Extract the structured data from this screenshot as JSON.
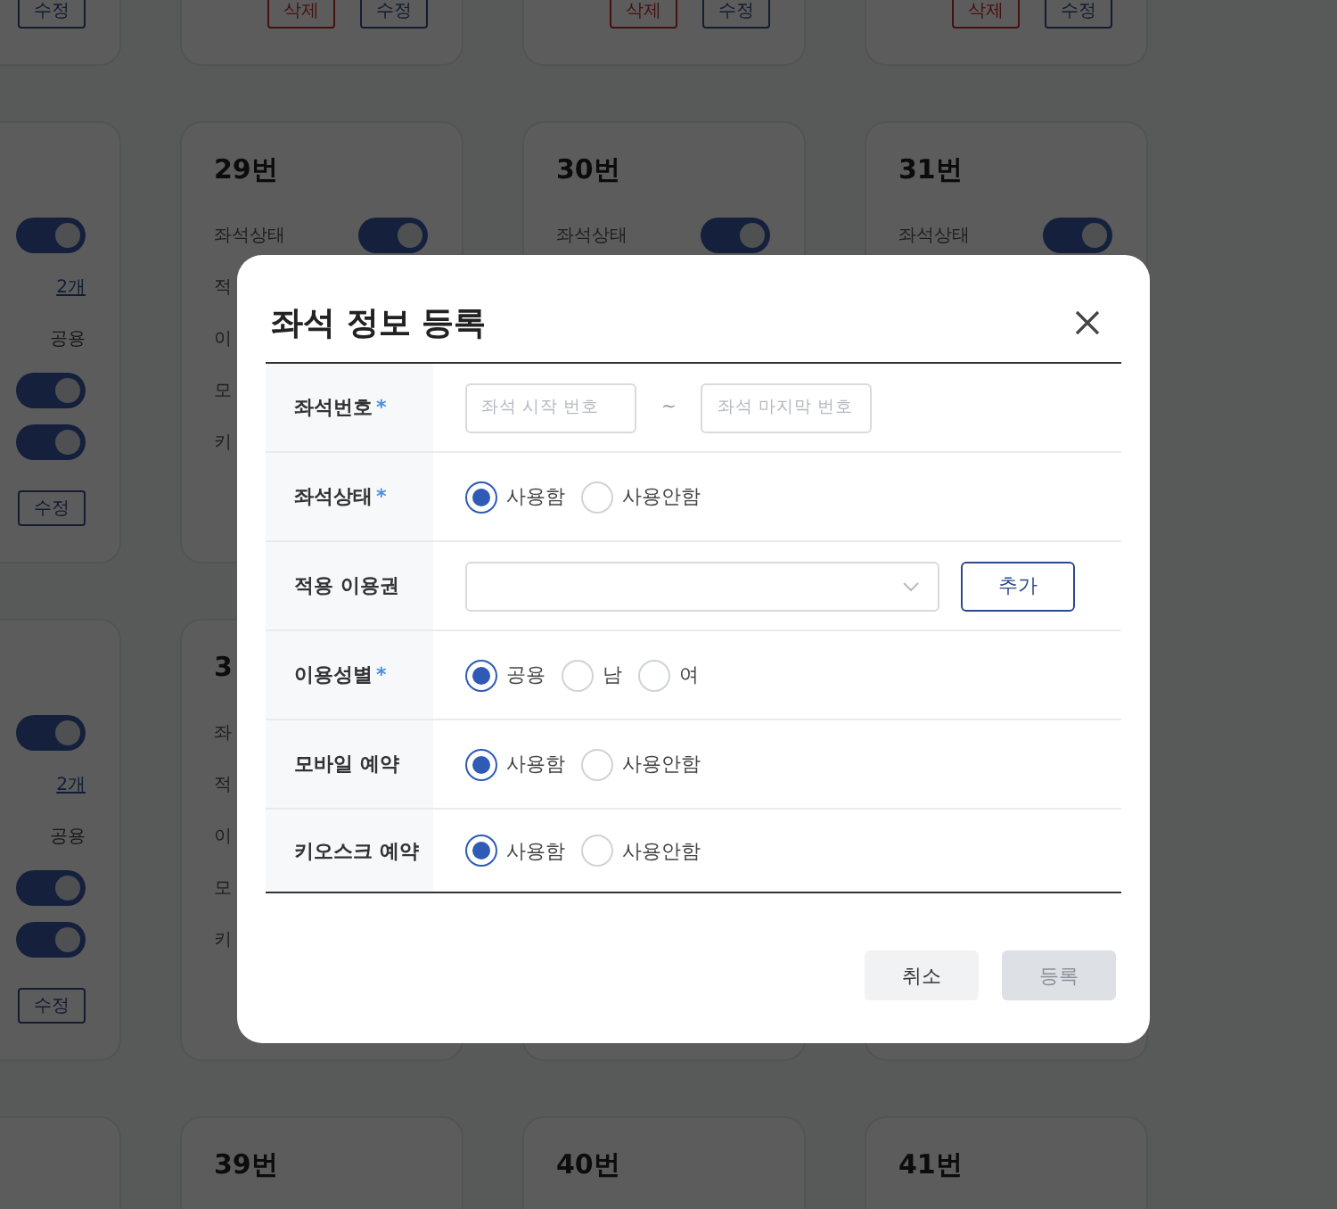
{
  "background": {
    "rows": [
      {
        "cards": [
          {
            "buttons": [
              {
                "label": "수정",
                "kind": "edit"
              }
            ]
          },
          {
            "buttons": [
              {
                "label": "삭제",
                "kind": "delete"
              },
              {
                "label": "수정",
                "kind": "edit"
              }
            ]
          },
          {
            "buttons": [
              {
                "label": "삭제",
                "kind": "delete"
              },
              {
                "label": "수정",
                "kind": "edit"
              }
            ]
          },
          {
            "buttons": [
              {
                "label": "삭제",
                "kind": "delete"
              },
              {
                "label": "수정",
                "kind": "edit"
              }
            ]
          }
        ]
      },
      {
        "cards": [
          {
            "fields": [
              {
                "kind": "toggle",
                "on": true
              },
              {
                "kind": "link",
                "value": "2개"
              },
              {
                "kind": "text",
                "value": "공용"
              },
              {
                "kind": "toggle",
                "on": true
              },
              {
                "kind": "toggle",
                "on": true
              }
            ],
            "buttons": [
              {
                "label": "수정",
                "kind": "edit"
              }
            ]
          },
          {
            "title": "29번",
            "fields": [
              {
                "label": "좌석상태",
                "kind": "toggle",
                "on": true
              },
              {
                "label": "적",
                "kind": "label"
              },
              {
                "label": "이",
                "kind": "label"
              },
              {
                "label": "모",
                "kind": "label"
              },
              {
                "label": "키",
                "kind": "label"
              }
            ]
          },
          {
            "title": "30번",
            "fields": [
              {
                "label": "좌석상태",
                "kind": "toggle",
                "on": true
              }
            ]
          },
          {
            "title": "31번",
            "fields": [
              {
                "label": "좌석상태",
                "kind": "toggle",
                "on": true
              }
            ]
          }
        ]
      },
      {
        "cards": [
          {
            "fields": [
              {
                "kind": "toggle",
                "on": true
              },
              {
                "kind": "link",
                "value": "2개"
              },
              {
                "kind": "text",
                "value": "공용"
              },
              {
                "kind": "toggle",
                "on": true
              },
              {
                "kind": "toggle",
                "on": true
              }
            ],
            "buttons": [
              {
                "label": "수정",
                "kind": "edit"
              }
            ]
          },
          {
            "title": "3",
            "fields": [
              {
                "label": "좌",
                "kind": "label"
              },
              {
                "label": "적",
                "kind": "label"
              },
              {
                "label": "이",
                "kind": "label"
              },
              {
                "label": "모",
                "kind": "label"
              },
              {
                "label": "키",
                "kind": "label"
              }
            ]
          },
          {
            "kind": "blank"
          },
          {
            "kind": "blank"
          }
        ]
      },
      {
        "cards": [
          {
            "kind": "blank"
          },
          {
            "title": "39번"
          },
          {
            "title": "40번"
          },
          {
            "title": "41번"
          }
        ]
      }
    ]
  },
  "dialog": {
    "title": "좌석 정보 등록",
    "fields": [
      {
        "label": "좌석번호",
        "required_mark": "*",
        "kind": "range",
        "inputs": [
          {
            "placeholder": "좌석 시작 번호"
          },
          {
            "placeholder": "좌석 마지막 번호"
          }
        ],
        "separator": "~"
      },
      {
        "label": "좌석상태",
        "required_mark": "*",
        "kind": "radio",
        "options": [
          {
            "label": "사용함",
            "selected": true
          },
          {
            "label": "사용안함",
            "selected": false
          }
        ]
      },
      {
        "label": "적용 이용권",
        "kind": "select",
        "button": "추가"
      },
      {
        "label": "이용성별",
        "required_mark": "*",
        "kind": "radio",
        "options": [
          {
            "label": "공용",
            "selected": true
          },
          {
            "label": "남",
            "selected": false
          },
          {
            "label": "여",
            "selected": false
          }
        ]
      },
      {
        "label": "모바일 예약",
        "kind": "radio",
        "options": [
          {
            "label": "사용함",
            "selected": true
          },
          {
            "label": "사용안함",
            "selected": false
          }
        ]
      },
      {
        "label": "키오스크 예약",
        "kind": "radio",
        "options": [
          {
            "label": "사용함",
            "selected": true
          },
          {
            "label": "사용안함",
            "selected": false
          }
        ]
      }
    ],
    "buttons": [
      {
        "label": "취소",
        "disabled": false
      },
      {
        "label": "등록",
        "disabled": true
      }
    ]
  }
}
